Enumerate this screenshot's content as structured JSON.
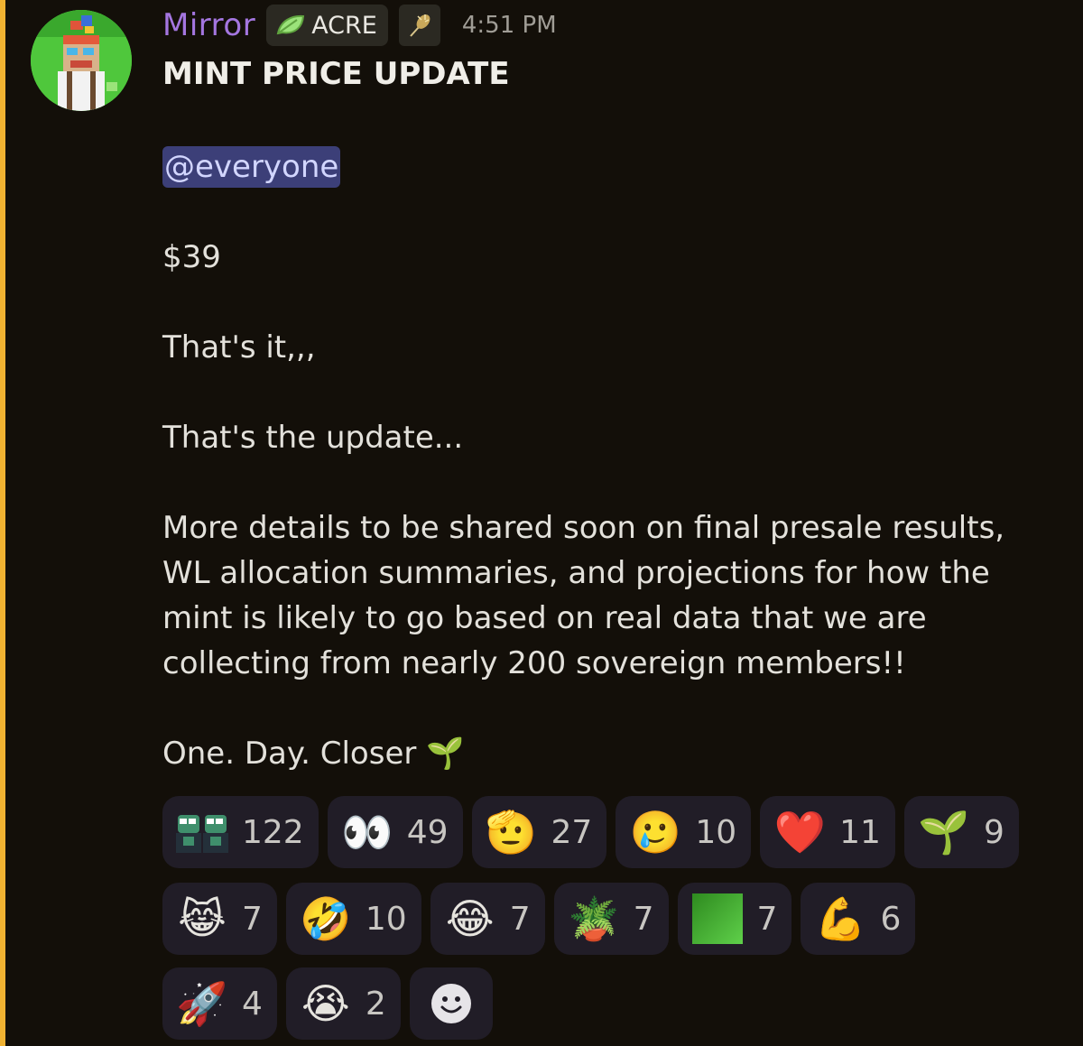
{
  "author": {
    "name": "Mirror",
    "tag_label": "ACRE",
    "timestamp": "4:51 PM"
  },
  "message": {
    "title": "MINT PRICE UPDATE",
    "mention": "@everyone",
    "lines": [
      "$39",
      "That's it,,,",
      "That's the update...",
      "More details to be shared soon on final presale results, WL allocation summaries, and projections for how the mint is likely to go based on real data that we are collecting from nearly 200 sovereign members!!",
      "One. Day. Closer 🌱"
    ]
  },
  "reactions": [
    {
      "icon": "frog-pair-icon",
      "emoji": "",
      "count": "122"
    },
    {
      "icon": "eyes-icon",
      "emoji": "👀",
      "count": "49"
    },
    {
      "icon": "saluting-face-icon",
      "emoji": "🫡",
      "count": "27"
    },
    {
      "icon": "tear-smile-icon",
      "emoji": "🥲",
      "count": "10"
    },
    {
      "icon": "red-heart-icon",
      "emoji": "❤️",
      "count": "11"
    },
    {
      "icon": "seedling-icon",
      "emoji": "🌱",
      "count": "9"
    },
    {
      "icon": "cat-joy-icon",
      "emoji": "😹",
      "count": "7"
    },
    {
      "icon": "rofl-icon",
      "emoji": "🤣",
      "count": "10"
    },
    {
      "icon": "joy-icon",
      "emoji": "😂",
      "count": "7"
    },
    {
      "icon": "potted-plant-icon",
      "emoji": "🪴",
      "count": "7"
    },
    {
      "icon": "green-square-icon",
      "emoji": "",
      "count": "7"
    },
    {
      "icon": "flexed-biceps-icon",
      "emoji": "💪",
      "count": "6"
    },
    {
      "icon": "rocket-icon",
      "emoji": "🚀",
      "count": "4"
    },
    {
      "icon": "sob-icon",
      "emoji": "😭",
      "count": "2"
    }
  ],
  "colors": {
    "background": "#130f09",
    "mention_bar": "#f0b232",
    "username": "#a476e0",
    "mention_bg": "#3c3f78",
    "reaction_bg": "#211d27"
  }
}
